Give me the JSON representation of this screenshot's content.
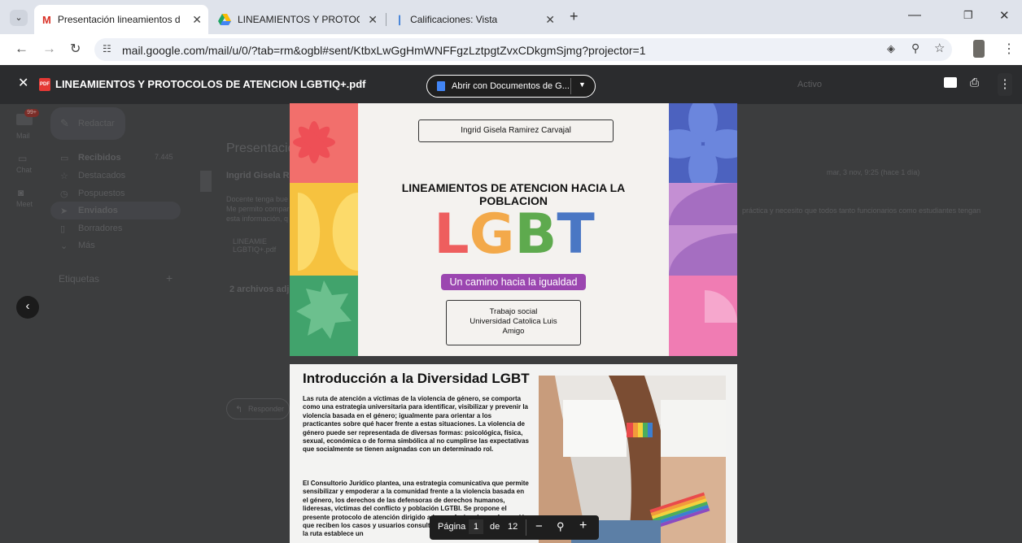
{
  "browser": {
    "tabs": [
      {
        "title": "Presentación lineamientos de a",
        "icon": "gmail-icon",
        "active": true
      },
      {
        "title": "LINEAMIENTOS Y PROTOCOLO",
        "icon": "google-drive-icon",
        "active": false
      },
      {
        "title": "Calificaciones: Vista",
        "icon": "moodle-icon",
        "active": false
      }
    ],
    "url": "mail.google.com/mail/u/0/?tab=rm&ogbl#sent/KtbxLwGgHmWNFFgzLztpgtZvxCDkgmSjmg?projector=1"
  },
  "gmail": {
    "badge": "99+",
    "rail": [
      "Mail",
      "Chat",
      "Meet"
    ],
    "compose": "Redactar",
    "nav": [
      "Recibidos",
      "Destacados",
      "Pospuestos",
      "Enviados",
      "Borradores",
      "Más"
    ],
    "nav_count": "7.445",
    "labels": "Etiquetas",
    "subject": "Presentación",
    "sender": "Ingrid Gisela Ra",
    "body_start": "Docente tenga bue",
    "body_line2": "Me permito compar",
    "body_line3": "esta información, q",
    "body_right": "práctica y necesito que todos tanto funcionarios como estudiantes tengan",
    "attachment_short": "LINEAMIE LGBTIQ+.pdf",
    "attachments": "2 archivos adju",
    "reply": "Responder",
    "date": "mar, 3 nov, 9:25 (hace 1 día)",
    "status": "Activo"
  },
  "viewer": {
    "filename": "LINEAMIENTOS Y PROTOCOLOS DE ATENCION LGBTIQ+.pdf",
    "open_with": "Abrir con Documentos de G...",
    "page_label": "Página",
    "page_current": "1",
    "page_of": "de",
    "page_total": "12"
  },
  "page1": {
    "author": "Ingrid Gisela Ramirez Carvajal",
    "title_line1": "LINEAMIENTOS DE ATENCION HACIA LA",
    "title_line2": "POBLACION",
    "letters": [
      "L",
      "G",
      "B",
      "T"
    ],
    "letter_colors": [
      "#ee5e5e",
      "#f3a94a",
      "#5eaa4e",
      "#4a77c4"
    ],
    "subtitle": "Un camino hacia la igualdad",
    "subtitle_color": "#9b46b0",
    "box_line1": "Trabajo social",
    "box_line2": "Universidad Catolica Luis",
    "box_line3": "Amigo"
  },
  "page2": {
    "heading": "Introducción a la Diversidad LGBT",
    "para1": "Las ruta de atención a víctimas de la violencia de género, se comporta como una estrategia universitaria para identificar, visibilizar y prevenir la violencia basada en el género; igualmente para orientar a los practicantes sobre qué hacer frente a estas situaciones. La violencia de género puede ser representada de diversas formas: psicológica, física, sexual, económica o de forma simbólica al no cumplirse las expectativas que socialmente se tienen asignadas con un determinado rol.",
    "para2": "El Consultorio Jurídico plantea, una estrategia comunicativa que permite sensibilizar y empoderar a la comunidad frente a la violencia basada en el género, los derechos de las defensoras de derechos humanos, lideresas, víctimas del conflicto y población LGTBI. Se propone el presente protocolo de atención dirigido a los profesionales en formación que reciben los casos y usuarios consultantes. Para los profesionales, la ruta establece un"
  }
}
